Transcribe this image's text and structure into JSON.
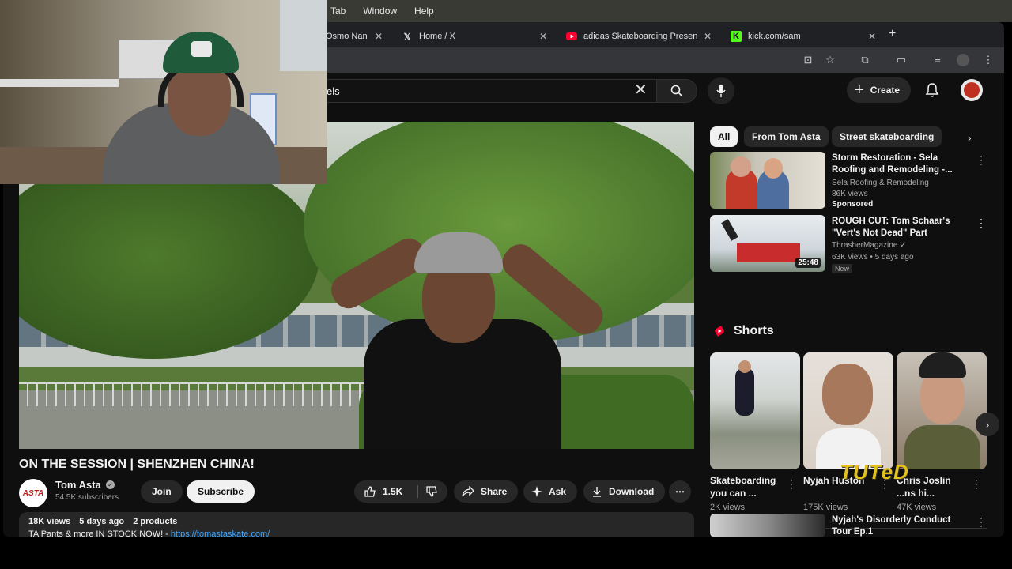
{
  "menubar": {
    "items": [
      "Tab",
      "Window",
      "Help"
    ]
  },
  "tabs": [
    {
      "label": "Osmo Nan",
      "icon": "osmo-icon"
    },
    {
      "label": "Home / X",
      "icon": "x-logo-icon"
    },
    {
      "label": "adidas Skateboarding Presen",
      "icon": "youtube-icon"
    },
    {
      "label": "kick.com/sam",
      "icon": "kick-icon"
    }
  ],
  "search": {
    "query": "els"
  },
  "header": {
    "create_label": "Create"
  },
  "video": {
    "title": "ON THE SESSION | SHENZHEN CHINA!",
    "channel": "Tom Asta",
    "channel_avatar_text": "ASTA",
    "subscribers": "54.5K subscribers",
    "join_label": "Join",
    "subscribe_label": "Subscribe",
    "likes": "1.5K",
    "share_label": "Share",
    "ask_label": "Ask",
    "download_label": "Download",
    "views": "18K views",
    "age": "5 days ago",
    "products": "2 products",
    "desc_text": "TA Pants & more IN STOCK NOW! - ",
    "desc_link": "https://tomastaskate.com/"
  },
  "chips": [
    "All",
    "From Tom Asta",
    "Street skateboarding"
  ],
  "recommendations": [
    {
      "title": "Storm Restoration - Sela Roofing and Remodeling -...",
      "channel": "Sela Roofing & Remodeling",
      "meta": "86K views",
      "badge": "Sponsored"
    },
    {
      "title": "ROUGH CUT: Tom Schaar's \"Vert's Not Dead\" Part",
      "channel": "ThrasherMagazine",
      "meta": "63K views • 5 days ago",
      "duration": "25:48",
      "badge": "New"
    },
    {
      "title": "Nyjah's Disorderly Conduct Tour Ep.1"
    }
  ],
  "shorts": {
    "heading": "Shorts",
    "items": [
      {
        "title": "Skateboarding you can ...",
        "views": "2K views"
      },
      {
        "title": "Nyjah Huston",
        "views": "175K views"
      },
      {
        "title": "Chris Joslin",
        "title_tail": "...ns hi...",
        "views": "47K views"
      }
    ]
  },
  "watermark": "TUTeD",
  "colors": {
    "background": "#0f0f0f",
    "accent_red": "#ff0033",
    "link_blue": "#3ea6ff"
  }
}
